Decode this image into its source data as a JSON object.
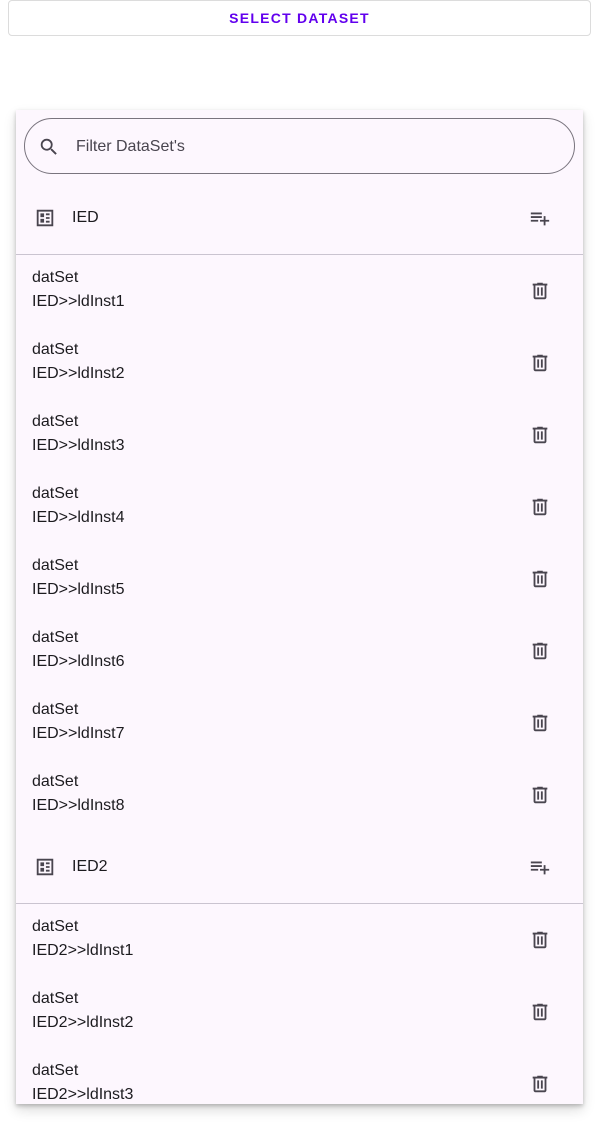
{
  "top_button": {
    "label": "SELECT DATASET"
  },
  "search": {
    "placeholder": "Filter DataSet's",
    "value": ""
  },
  "colors": {
    "accent": "#6200ee",
    "panel_bg": "#fdf7fe",
    "divider": "#cac4d0",
    "icon": "#49454f"
  },
  "icons": {
    "search": "search-icon",
    "ied": "ied-icon",
    "add": "playlist-add-icon",
    "delete": "delete-icon"
  },
  "groups": [
    {
      "name": "IED",
      "items": [
        {
          "line1": "datSet",
          "line2": "IED>>ldInst1"
        },
        {
          "line1": "datSet",
          "line2": "IED>>ldInst2"
        },
        {
          "line1": "datSet",
          "line2": "IED>>ldInst3"
        },
        {
          "line1": "datSet",
          "line2": "IED>>ldInst4"
        },
        {
          "line1": "datSet",
          "line2": "IED>>ldInst5"
        },
        {
          "line1": "datSet",
          "line2": "IED>>ldInst6"
        },
        {
          "line1": "datSet",
          "line2": "IED>>ldInst7"
        },
        {
          "line1": "datSet",
          "line2": "IED>>ldInst8"
        }
      ]
    },
    {
      "name": "IED2",
      "items": [
        {
          "line1": "datSet",
          "line2": "IED2>>ldInst1"
        },
        {
          "line1": "datSet",
          "line2": "IED2>>ldInst2"
        },
        {
          "line1": "datSet",
          "line2": "IED2>>ldInst3"
        }
      ]
    }
  ]
}
